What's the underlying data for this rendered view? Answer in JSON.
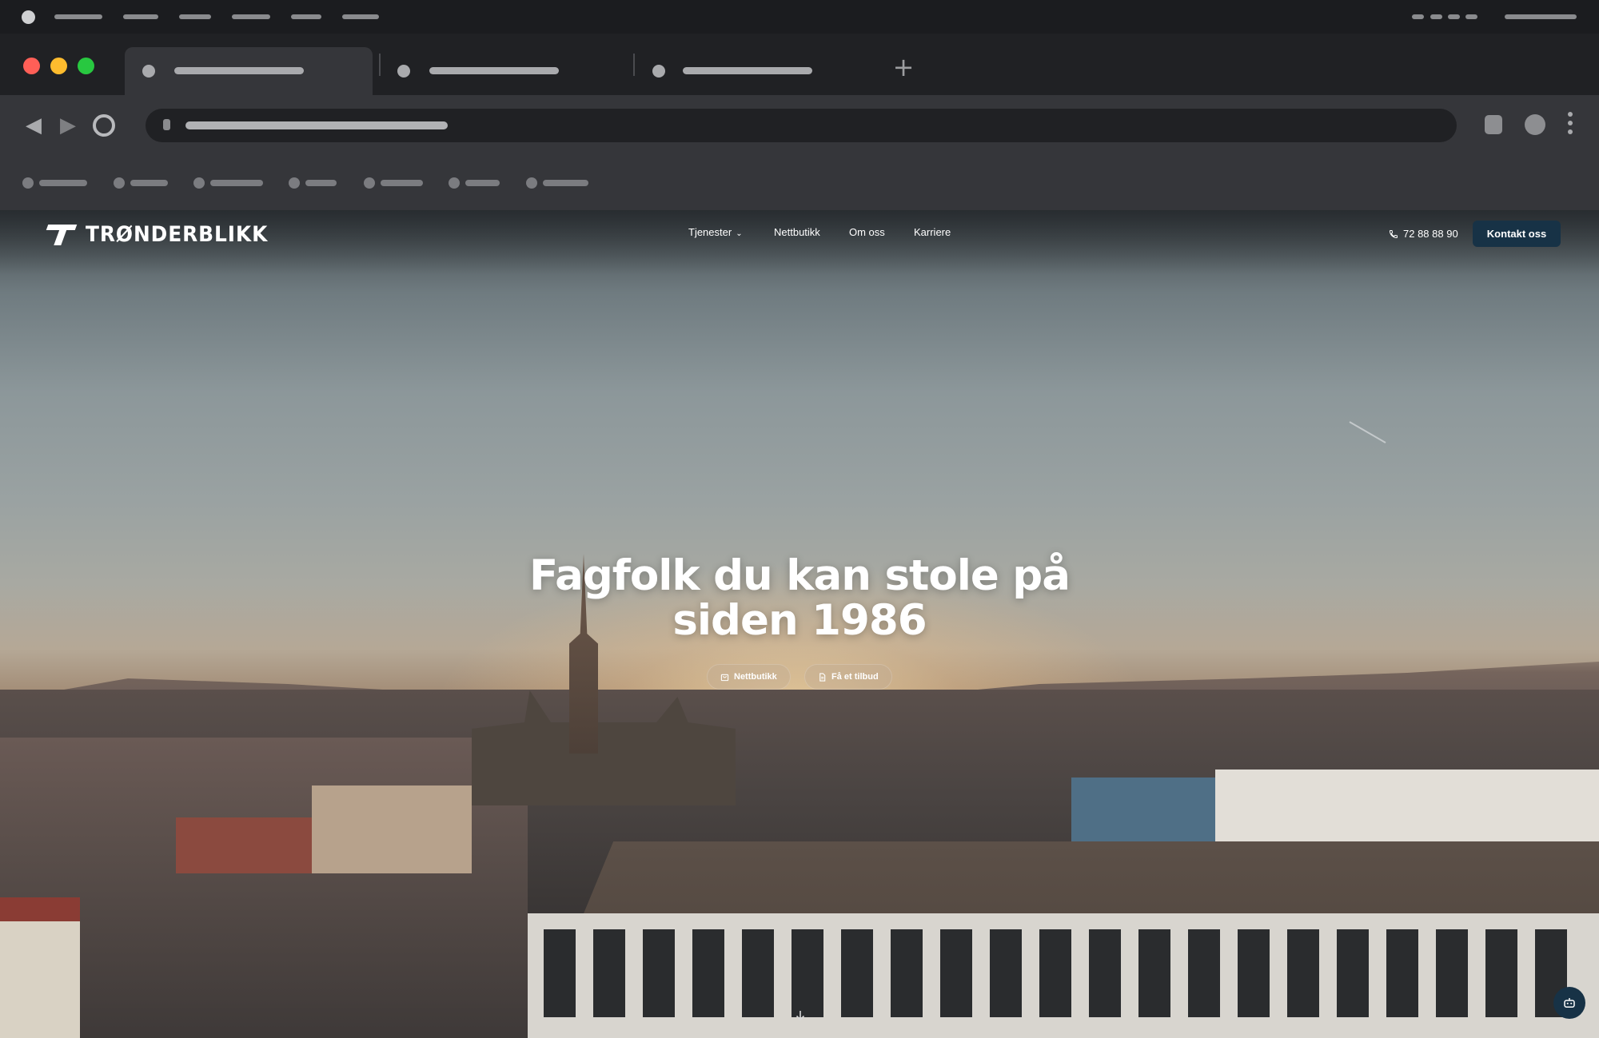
{
  "browser": {
    "traffic_lights": {
      "close": "#ff5f57",
      "minimize": "#febc2e",
      "zoom": "#28c840"
    },
    "new_tab_glyph": "+",
    "back_glyph": "◀",
    "forward_glyph": "▶"
  },
  "site": {
    "logo_text": "TRØNDERBLIKK",
    "nav": {
      "services": "Tjenester",
      "services_chevron": "⌄",
      "webshop": "Nettbutikk",
      "about": "Om oss",
      "careers": "Karriere"
    },
    "phone": "72 88 88 90",
    "contact_button": "Kontakt oss",
    "brand_color": "#173246"
  },
  "hero": {
    "title_line1": "Fagfolk du kan stole på",
    "title_line2": "siden 1986",
    "btn_webshop": "Nettbutikk",
    "btn_quote": "Få et tilbud"
  },
  "icons": {
    "phone": "phone-icon",
    "cart": "cart-icon",
    "document": "document-icon",
    "scroll": "arrow-down-icon",
    "chat": "chat-bot-icon"
  }
}
